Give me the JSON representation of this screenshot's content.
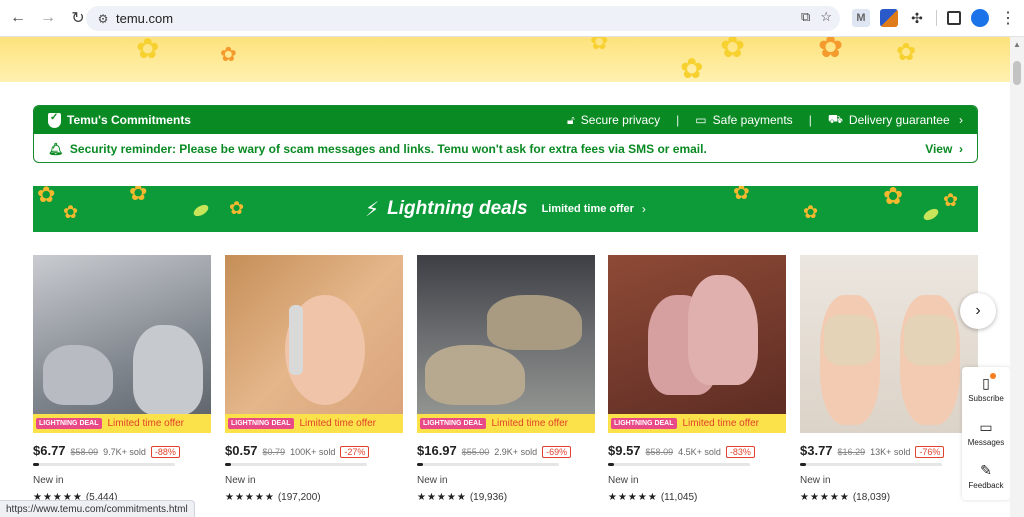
{
  "browser": {
    "url": "temu.com",
    "status_url": "https://www.temu.com/commitments.html"
  },
  "commitments": {
    "title": "Temu's Commitments",
    "items": [
      "Secure privacy",
      "Safe payments",
      "Delivery guarantee"
    ],
    "reminder": "Security reminder: Please be wary of scam messages and links. Temu won't ask for extra fees via SMS or email.",
    "view_label": "View"
  },
  "deals": {
    "title": "Lightning deals",
    "subtitle": "Limited time offer"
  },
  "products": [
    {
      "price": "$6.77",
      "old": "$58.09",
      "sold": "9.7K+ sold",
      "off": "-88%",
      "badge": "Limited time offer",
      "tag": "LIGHTNING DEAL",
      "newin": "New in",
      "stars": "★★★★★",
      "reviews": "(5,444)"
    },
    {
      "price": "$0.57",
      "old": "$0.79",
      "sold": "100K+ sold",
      "off": "-27%",
      "badge": "Limited time offer",
      "tag": "LIGHTNING DEAL",
      "newin": "New in",
      "stars": "★★★★★",
      "reviews": "(197,200)"
    },
    {
      "price": "$16.97",
      "old": "$55.00",
      "sold": "2.9K+ sold",
      "off": "-69%",
      "badge": "Limited time offer",
      "tag": "LIGHTNING DEAL",
      "newin": "New in",
      "stars": "★★★★★",
      "reviews": "(19,936)"
    },
    {
      "price": "$9.57",
      "old": "$58.09",
      "sold": "4.5K+ sold",
      "off": "-83%",
      "badge": "Limited time offer",
      "tag": "LIGHTNING DEAL",
      "newin": "New in",
      "stars": "★★★★★",
      "reviews": "(11,045)"
    },
    {
      "price": "$3.77",
      "old": "$16.29",
      "sold": "13K+ sold",
      "off": "-76%",
      "badge": "",
      "tag": "",
      "newin": "New in",
      "stars": "★★★★★",
      "reviews": "(18,039)"
    }
  ],
  "side": {
    "subscribe": "Subscribe",
    "messages": "Messages",
    "feedback": "Feedback"
  },
  "colors": {
    "brand_green": "#0a8a23",
    "accent_orange": "#f57c1f",
    "discount_red": "#e0422b"
  }
}
